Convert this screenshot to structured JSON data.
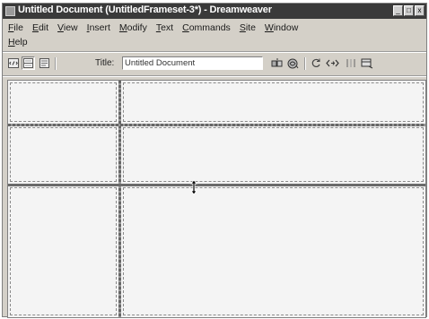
{
  "window": {
    "title": "Untitled Document (UntitledFrameset-3*) - Dreamweaver",
    "buttons": [
      "_",
      "□",
      "x"
    ]
  },
  "menubar": {
    "row1": [
      {
        "label": "File",
        "mnemonic": "F",
        "rest": "ile"
      },
      {
        "label": "Edit",
        "mnemonic": "E",
        "rest": "dit"
      },
      {
        "label": "View",
        "mnemonic": "V",
        "rest": "iew"
      },
      {
        "label": "Insert",
        "mnemonic": "I",
        "rest": "nsert"
      },
      {
        "label": "Modify",
        "mnemonic": "M",
        "rest": "odify"
      },
      {
        "label": "Text",
        "mnemonic": "T",
        "rest": "ext"
      },
      {
        "label": "Commands",
        "mnemonic": "C",
        "rest": "ommands"
      },
      {
        "label": "Site",
        "mnemonic": "S",
        "rest": "ite"
      },
      {
        "label": "Window",
        "mnemonic": "W",
        "rest": "indow"
      }
    ],
    "row2": [
      {
        "label": "Help",
        "mnemonic": "H",
        "rest": "elp"
      }
    ]
  },
  "toolbar": {
    "view_buttons": [
      "code-view-icon",
      "split-view-icon",
      "design-view-icon"
    ],
    "title_label": "Title:",
    "title_value": "Untitled Document",
    "right_buttons": [
      "file-management-icon",
      "preview-browser-icon",
      "refresh-icon",
      "code-navigation-icon",
      "view-options-icon",
      "layout-icon"
    ]
  },
  "frameset": {
    "columns": 2,
    "rows": 3,
    "cursor": "resize-vertical-cursor"
  }
}
